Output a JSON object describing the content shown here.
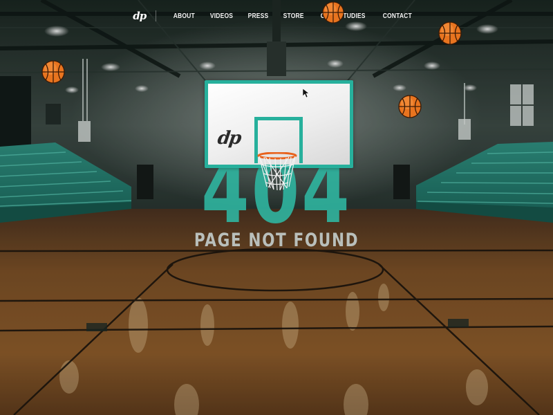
{
  "nav": {
    "logo": "dp",
    "items": [
      "ABOUT",
      "VIDEOS",
      "PRESS",
      "STORE",
      "CASE STUDIES",
      "CONTACT"
    ]
  },
  "error": {
    "code": "404",
    "message": "PAGE NOT FOUND"
  },
  "backboard": {
    "logo": "dp"
  },
  "icons": {
    "basketball": "basketball-icon",
    "cursor": "cursor-icon",
    "hoop": "hoop-icon"
  },
  "colors": {
    "accent": "#27b09c",
    "floor": "#8a5a2a",
    "text_light": "#b9bfbb"
  }
}
